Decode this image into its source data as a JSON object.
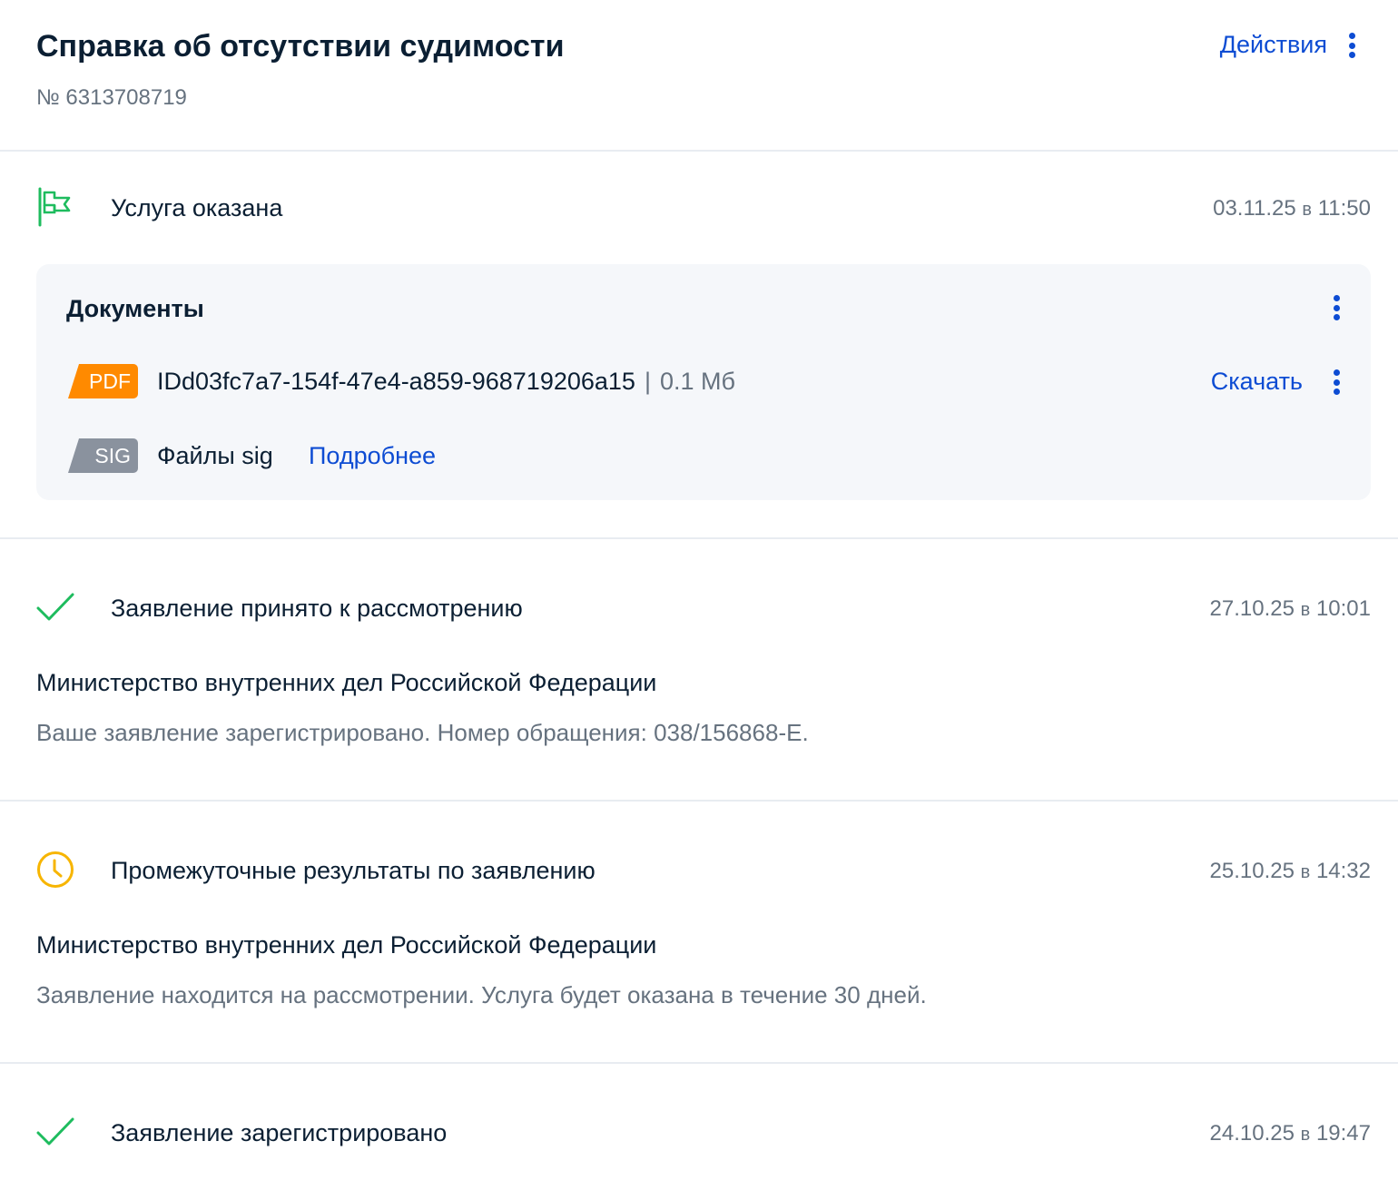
{
  "header": {
    "title": "Справка об отсутствии судимости",
    "number": "№ 6313708719",
    "actions_label": "Действия"
  },
  "events": [
    {
      "status": "Услуга оказана",
      "date": "03.11.25",
      "sep": "в",
      "time": "11:50",
      "icon": "flag-icon",
      "icon_color": "#1ebc5e"
    },
    {
      "status": "Заявление принято к рассмотрению",
      "date": "27.10.25",
      "sep": "в",
      "time": "10:01",
      "icon": "check-icon",
      "icon_color": "#1ebc5e",
      "org": "Министерство внутренних дел Российской Федерации",
      "description": "Ваше заявление зарегистрировано. Номер обращения: 038/156868-Е."
    },
    {
      "status": "Промежуточные результаты по заявлению",
      "date": "25.10.25",
      "sep": "в",
      "time": "14:32",
      "icon": "clock-icon",
      "icon_color": "#f7b500",
      "org": "Министерство внутренних дел Российской Федерации",
      "description": "Заявление находится на рассмотрении. Услуга будет оказана в течение 30 дней."
    },
    {
      "status": "Заявление зарегистрировано",
      "date": "24.10.25",
      "sep": "в",
      "time": "19:47",
      "icon": "check-icon",
      "icon_color": "#1ebc5e"
    }
  ],
  "documents": {
    "title": "Документы",
    "file": {
      "badge": "PDF",
      "name": "IDd03fc7a7-154f-47e4-a859-968719206a15",
      "separator": "|",
      "size": "0.1 Мб",
      "download_label": "Скачать"
    },
    "sig": {
      "badge": "SIG",
      "label": "Файлы sig",
      "more_label": "Подробнее"
    }
  },
  "colors": {
    "accent": "#0d4cd3",
    "success": "#1ebc5e",
    "warning": "#f7b500",
    "pdf_badge": "#ff8a00",
    "sig_badge": "#8a929e"
  }
}
